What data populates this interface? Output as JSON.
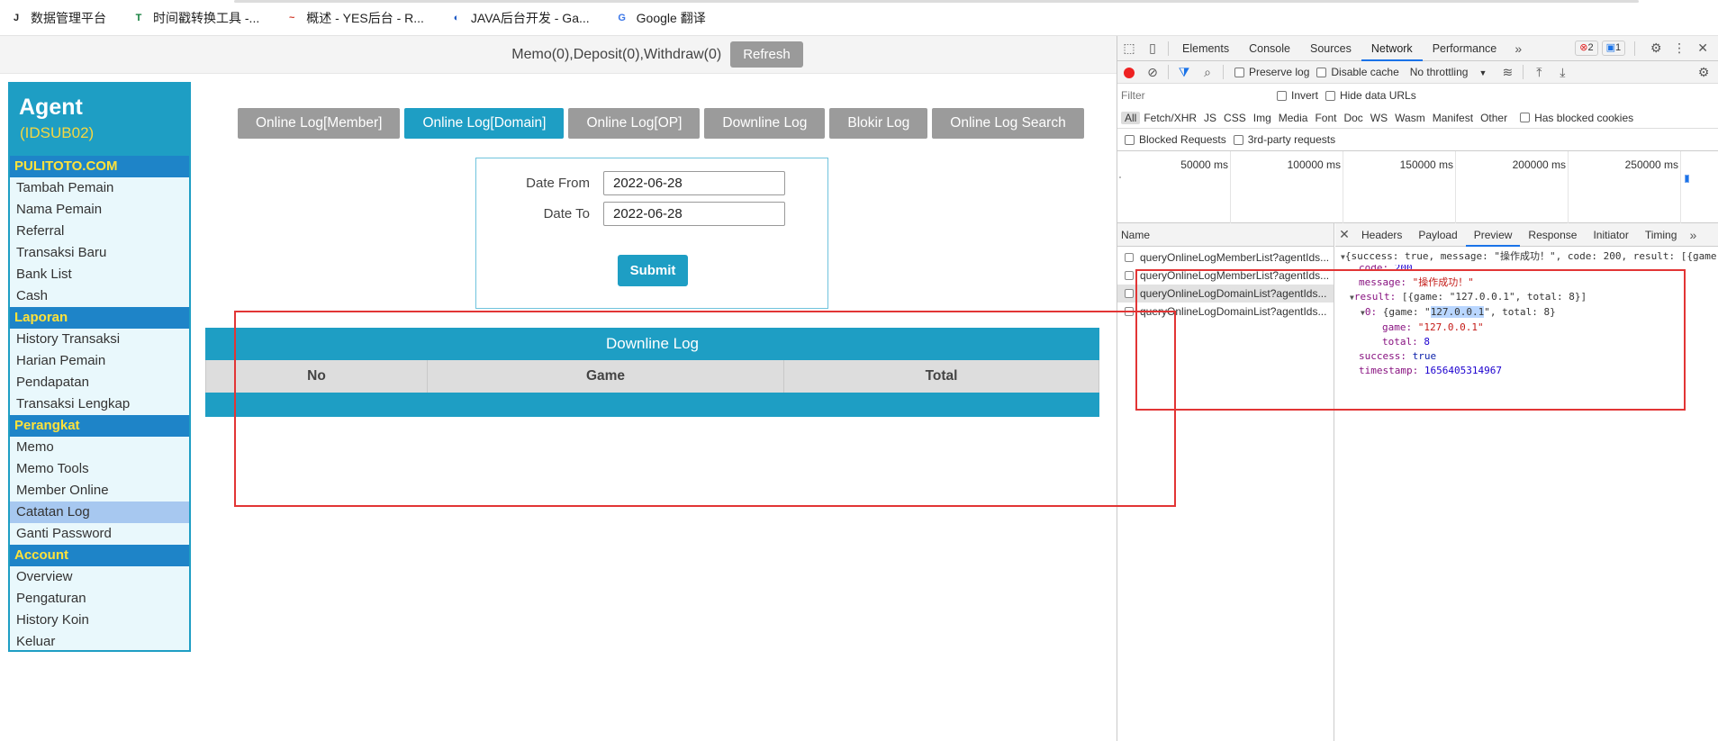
{
  "bookmarks": [
    {
      "icon": "J",
      "label": "数据管理平台",
      "color": "#222222"
    },
    {
      "icon": "T",
      "label": "时间戳转换工具 -...",
      "color": "#0f7d3a"
    },
    {
      "icon": "~",
      "label": "概述 - YES后台 - R...",
      "color": "#d23a2a"
    },
    {
      "icon": "◐",
      "label": "JAVA后台开发 - Ga...",
      "color": "#1a57c4"
    },
    {
      "icon": "G",
      "label": "Google 翻译",
      "color": "#3a76e8"
    }
  ],
  "topbar": {
    "status": "Memo(0),Deposit(0),Withdraw(0)",
    "refresh_label": "Refresh"
  },
  "sidebar": {
    "title": "Agent",
    "subtitle": "(IDSUB02)",
    "sections": [
      {
        "title": "PULITOTO.COM",
        "items": [
          "Tambah Pemain",
          "Nama Pemain",
          "Referral",
          "Transaksi Baru",
          "Bank List",
          "Cash"
        ]
      },
      {
        "title": "Laporan",
        "items": [
          "History Transaksi",
          "Harian Pemain",
          "Pendapatan",
          "Transaksi Lengkap"
        ]
      },
      {
        "title": "Perangkat",
        "items": [
          "Memo",
          "Memo Tools",
          "Member Online",
          "Catatan Log",
          "Ganti Password"
        ]
      },
      {
        "title": "Account",
        "items": [
          "Overview",
          "Pengaturan",
          "History Koin",
          "Keluar"
        ]
      }
    ],
    "active_item": "Catatan Log"
  },
  "tabs": [
    {
      "label": "Online Log[Member]",
      "active": false
    },
    {
      "label": "Online Log[Domain]",
      "active": true
    },
    {
      "label": "Online Log[OP]",
      "active": false
    },
    {
      "label": "Downline Log",
      "active": false
    },
    {
      "label": "Blokir Log",
      "active": false
    },
    {
      "label": "Online Log Search",
      "active": false
    }
  ],
  "form": {
    "date_from_label": "Date From",
    "date_from_value": "2022-06-28",
    "date_to_label": "Date To",
    "date_to_value": "2022-06-28",
    "submit_label": "Submit"
  },
  "log_table": {
    "title": "Downline Log",
    "columns": [
      "No",
      "Game",
      "Total"
    ]
  },
  "devtools": {
    "tabs": [
      "Elements",
      "Console",
      "Sources",
      "Network",
      "Performance"
    ],
    "active_tab": "Network",
    "badge_errors": "2",
    "badge_messages": "1",
    "toolbar": {
      "preserve_log": "Preserve log",
      "disable_cache": "Disable cache",
      "throttling": "No throttling"
    },
    "filter_placeholder": "Filter",
    "invert": "Invert",
    "hide_data_urls": "Hide data URLs",
    "type_filters": [
      "All",
      "Fetch/XHR",
      "JS",
      "CSS",
      "Img",
      "Media",
      "Font",
      "Doc",
      "WS",
      "Wasm",
      "Manifest",
      "Other"
    ],
    "has_blocked_cookies": "Has blocked cookies",
    "blocked_requests": "Blocked Requests",
    "third_party": "3rd-party requests",
    "timeline_labels": [
      "50000 ms",
      "100000 ms",
      "150000 ms",
      "200000 ms",
      "250000 ms"
    ],
    "name_header": "Name",
    "requests": [
      "queryOnlineLogMemberList?agentIds...",
      "queryOnlineLogMemberList?agentIds...",
      "queryOnlineLogDomainList?agentIds...",
      "queryOnlineLogDomainList?agentIds..."
    ],
    "selected_request": 2,
    "detail_tabs": [
      "Headers",
      "Payload",
      "Preview",
      "Response",
      "Initiator",
      "Timing"
    ],
    "active_detail_tab": "Preview",
    "preview": {
      "summary": "{success: true, message: \"操作成功！\", code: 200, result: [{game",
      "code_label": "code: ",
      "code_value": "200",
      "message_label": "message: ",
      "message_value": "\"操作成功！\"",
      "result_label": "result: ",
      "result_value": "[{game: \"127.0.0.1\", total: 8}]",
      "item0_label": "0: ",
      "item0_prefix": "{game: \"",
      "item0_highlight": "127.0.0.1",
      "item0_suffix": "\", total: 8}",
      "game_label": "game: ",
      "game_value": "\"127.0.0.1\"",
      "total_label": "total: ",
      "total_value": "8",
      "success_label": "success: ",
      "success_value": "true",
      "timestamp_label": "timestamp: ",
      "timestamp_value": "1656405314967"
    }
  }
}
